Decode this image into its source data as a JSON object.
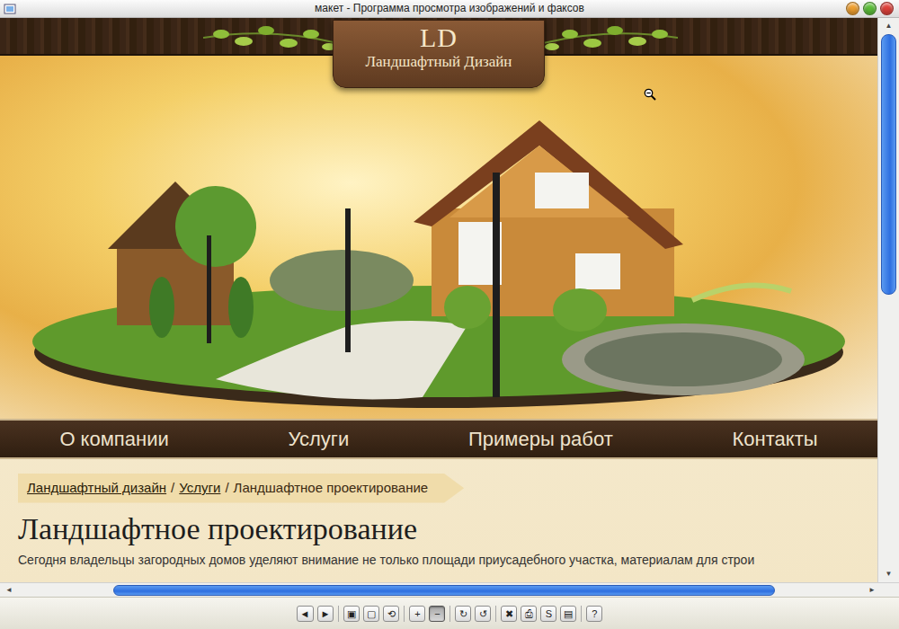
{
  "window": {
    "title": "макет - Программа просмотра изображений и факсов",
    "controls": [
      {
        "color": "#f0a030"
      },
      {
        "color": "#5cbf3a"
      },
      {
        "color": "#e0413a"
      }
    ]
  },
  "mockup": {
    "logo": {
      "mark": "LD",
      "title": "Ландшафтный Дизайн"
    },
    "nav": [
      "О компании",
      "Услуги",
      "Примеры работ",
      "Контакты"
    ],
    "breadcrumb": [
      {
        "label": "Ландшафтный дизайн",
        "link": true
      },
      {
        "label": "Услуги",
        "link": true
      },
      {
        "label": "Ландшафтное проектирование",
        "link": false
      }
    ],
    "separator": "/",
    "heading": "Ландшафтное проектирование",
    "paragraph": "Сегодня владельцы загородных домов уделяют внимание не только площади приусадебного участка, материалам для строи"
  },
  "scrollbars": {
    "up": "▲",
    "down": "▼",
    "left": "◄",
    "right": "►"
  },
  "toolbar": [
    [
      {
        "icon": "◄",
        "selected": false
      },
      {
        "icon": "►",
        "selected": false
      }
    ],
    [
      {
        "icon": "▣",
        "selected": false
      },
      {
        "icon": "▢",
        "selected": false
      },
      {
        "icon": "⟲",
        "selected": false
      }
    ],
    [
      {
        "icon": "+",
        "selected": false
      },
      {
        "icon": "−",
        "selected": true
      }
    ],
    [
      {
        "icon": "↻",
        "selected": false
      },
      {
        "icon": "↺",
        "selected": false
      }
    ],
    [
      {
        "icon": "✖",
        "selected": false
      },
      {
        "icon": "⎙",
        "selected": false
      },
      {
        "icon": "S",
        "selected": false
      },
      {
        "icon": "▤",
        "selected": false
      }
    ],
    [
      {
        "icon": "?",
        "selected": false
      }
    ]
  ]
}
